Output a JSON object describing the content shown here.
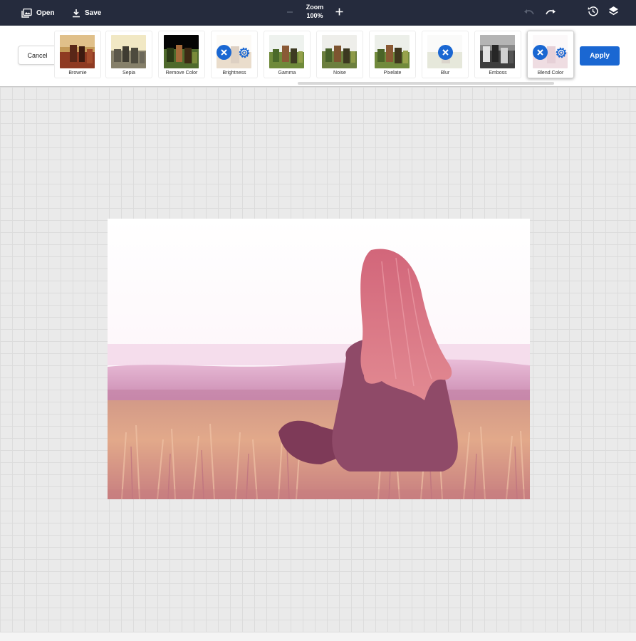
{
  "topbar": {
    "open_label": "Open",
    "save_label": "Save",
    "zoom_label": "Zoom",
    "zoom_value": "100%"
  },
  "toolbar": {
    "cancel_label": "Cancel",
    "apply_label": "Apply",
    "filters": [
      {
        "label": "Brownie",
        "has_controls": false
      },
      {
        "label": "Sepia",
        "has_controls": false
      },
      {
        "label": "Remove Color",
        "has_controls": false
      },
      {
        "label": "Brightness",
        "has_controls": true
      },
      {
        "label": "Gamma",
        "has_controls": false
      },
      {
        "label": "Noise",
        "has_controls": false
      },
      {
        "label": "Pixelate",
        "has_controls": false
      },
      {
        "label": "Blur",
        "has_controls": true
      },
      {
        "label": "Emboss",
        "has_controls": false
      },
      {
        "label": "Blend Color",
        "has_controls": true,
        "active": true
      }
    ]
  },
  "colors": {
    "topbar_bg": "#252b3d",
    "accent": "#1a67d2",
    "blend_tint": "#e07a9a"
  },
  "icons": {
    "open": "image-folder-icon",
    "save": "download-icon",
    "zoom_out": "minus-icon",
    "zoom_in": "plus-icon",
    "undo": "undo-icon",
    "redo": "redo-icon",
    "history": "history-icon",
    "layers": "layers-icon",
    "remove": "close-circle-icon",
    "settings": "gear-icon"
  }
}
